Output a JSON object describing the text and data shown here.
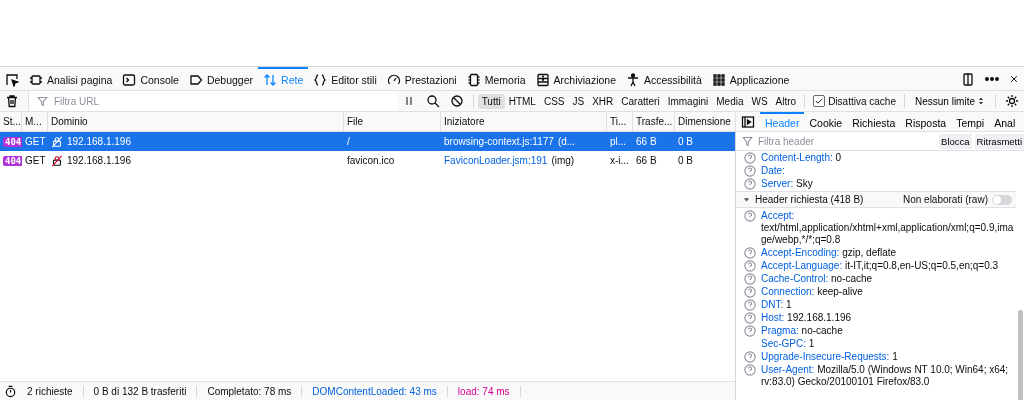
{
  "devtools_tabs": [
    {
      "selected": false
    },
    {
      "label": "Analisi pagina",
      "selected": false
    },
    {
      "label": "Console",
      "selected": false
    },
    {
      "label": "Debugger",
      "selected": false
    },
    {
      "label": "Rete",
      "selected": true
    },
    {
      "label": "Editor stili",
      "selected": false
    },
    {
      "label": "Prestazioni",
      "selected": false
    },
    {
      "label": "Memoria",
      "selected": false
    },
    {
      "label": "Archiviazione",
      "selected": false
    },
    {
      "label": "Accessibilità",
      "selected": false
    },
    {
      "label": "Applicazione",
      "selected": false
    }
  ],
  "toolbar": {
    "filter_placeholder": "Filtra URL",
    "type_filters": [
      {
        "label": "Tutti",
        "selected": true
      },
      {
        "label": "HTML",
        "selected": false
      },
      {
        "label": "CSS",
        "selected": false
      },
      {
        "label": "JS",
        "selected": false
      },
      {
        "label": "XHR",
        "selected": false
      },
      {
        "label": "Caratteri",
        "selected": false
      },
      {
        "label": "Immagini",
        "selected": false
      },
      {
        "label": "Media",
        "selected": false
      },
      {
        "label": "WS",
        "selected": false
      },
      {
        "label": "Altro",
        "selected": false
      }
    ],
    "disable_cache": {
      "label": "Disattiva cache",
      "checked": true
    },
    "throttling": "Nessun limite"
  },
  "table": {
    "columns": [
      "St...",
      "M...",
      "Dominio",
      "File",
      "Iniziatore",
      "Ti...",
      "Trasfe...",
      "Dimensione"
    ],
    "rows": [
      {
        "status": "404",
        "method": "GET",
        "domain": "192.168.1.196",
        "file": "/",
        "initiator": "browsing-context.js:1177",
        "initiator_cause": "(d...",
        "type": "pl...",
        "transferred": "66 B",
        "size": "0 B",
        "selected": true
      },
      {
        "status": "404",
        "method": "GET",
        "domain": "192.168.1.196",
        "file": "favicon.ico",
        "initiator": "FaviconLoader.jsm:191",
        "initiator_cause": "(img)",
        "type": "x-i...",
        "transferred": "66 B",
        "size": "0 B",
        "selected": false
      }
    ]
  },
  "status_bar": [
    {
      "text": "2 richieste",
      "kind": "plain"
    },
    {
      "text": "0 B di 132 B trasferiti",
      "kind": "plain"
    },
    {
      "text": "Completato: 78 ms",
      "kind": "plain"
    },
    {
      "text": "DOMContentLoaded: 43 ms",
      "kind": "dom"
    },
    {
      "text": "load: 74 ms",
      "kind": "load"
    }
  ],
  "details": {
    "tabs": [
      {
        "label": "Header",
        "selected": true
      },
      {
        "label": "Cookie",
        "selected": false
      },
      {
        "label": "Richiesta",
        "selected": false
      },
      {
        "label": "Risposta",
        "selected": false
      },
      {
        "label": "Tempi",
        "selected": false
      },
      {
        "label": "Anal",
        "selected": false
      }
    ],
    "filter_placeholder": "Filtra header",
    "buttons": [
      "Blocca",
      "Ritrasmetti"
    ],
    "response_headers": [
      {
        "name": "Content-Length:",
        "value": "0",
        "help": true
      },
      {
        "name": "Date:",
        "help": true
      },
      {
        "name": "Server:",
        "value": "Sky",
        "help": true
      }
    ],
    "request_section": {
      "title": "Header richiesta (418 B)",
      "expanded": true,
      "raw_label": "Non elaborati (raw)",
      "raw_on": false
    },
    "request_headers": [
      {
        "name": "Accept:",
        "value": "text/html,application/xhtml+xml,application/xml;q=0.9,image/webp,*/*;q=0.8",
        "help": true
      },
      {
        "name": "Accept-Encoding:",
        "value": "gzip, deflate",
        "help": true
      },
      {
        "name": "Accept-Language:",
        "value": "it-IT,it;q=0.8,en-US;q=0.5,en;q=0.3",
        "help": true
      },
      {
        "name": "Cache-Control:",
        "value": "no-cache",
        "help": true
      },
      {
        "name": "Connection:",
        "value": "keep-alive",
        "help": true
      },
      {
        "name": "DNT:",
        "value": "1",
        "help": true
      },
      {
        "name": "Host:",
        "value": "192.168.1.196",
        "help": true
      },
      {
        "name": "Pragma:",
        "value": "no-cache",
        "help": true
      },
      {
        "name": "Sec-GPC:",
        "value": "1",
        "help": false
      },
      {
        "name": "Upgrade-Insecure-Requests:",
        "value": "1",
        "help": true
      },
      {
        "name": "User-Agent:",
        "value": "Mozilla/5.0 (Windows NT 10.0; Win64; x64; rv:83.0) Gecko/20100101 Firefox/83.0",
        "help": true
      }
    ]
  }
}
